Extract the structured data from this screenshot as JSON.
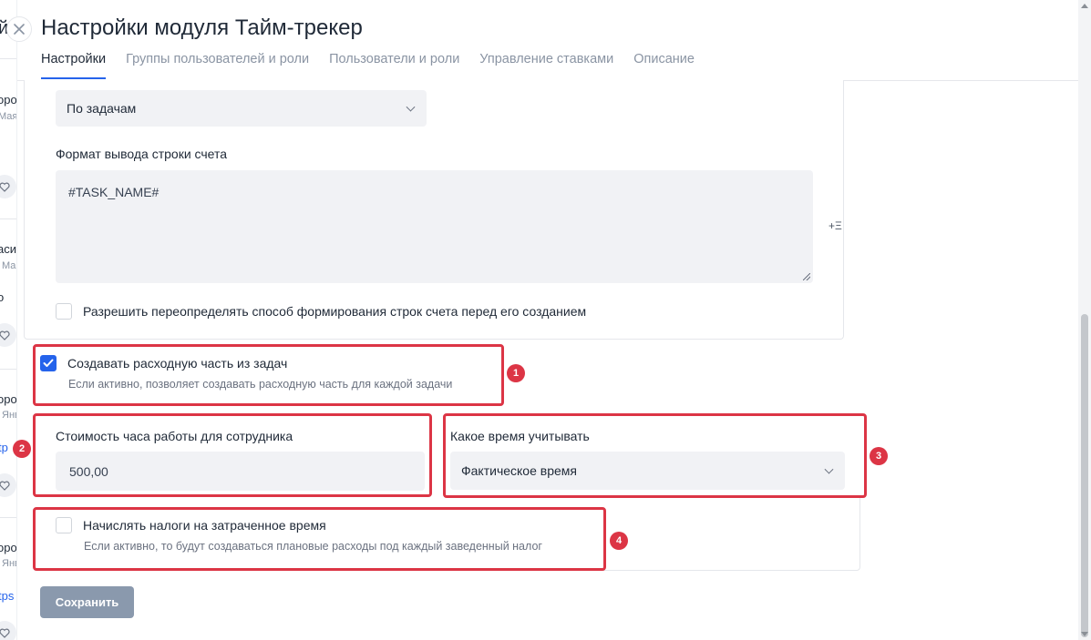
{
  "background": {
    "heading_fragment": "й",
    "items": [
      {
        "title": "оро",
        "sub": "Мая"
      },
      {
        "title": "асил",
        "sub": "Ма"
      },
      {
        "title": "оро",
        "sub": "Янв",
        "link": "tp"
      },
      {
        "title": "оро",
        "sub": "Янв",
        "link": "tps"
      }
    ],
    "stray_text": "о"
  },
  "modal": {
    "title": "Настройки модуля Тайм-трекер",
    "tabs": [
      {
        "label": "Настройки",
        "active": true
      },
      {
        "label": "Группы пользователей и роли",
        "active": false
      },
      {
        "label": "Пользователи и роли",
        "active": false
      },
      {
        "label": "Управление ставками",
        "active": false
      },
      {
        "label": "Описание",
        "active": false
      }
    ]
  },
  "form": {
    "grouping_select": {
      "value": "По задачам"
    },
    "invoice_format": {
      "label": "Формат вывода строки счета",
      "value": "#TASK_NAME#",
      "insert_icon": "+Ξ"
    },
    "allow_override": {
      "label": "Разрешить переопределять способ формирования строк счета перед его созданием",
      "checked": false
    },
    "create_expense": {
      "label": "Создавать расходную часть из задач",
      "hint": "Если активно, позволяет создавать расходную часть для каждой задачи",
      "checked": true
    },
    "hour_cost": {
      "label": "Стоимость часа работы для сотрудника",
      "value": "500,00"
    },
    "time_type": {
      "label": "Какое время учитывать",
      "value": "Фактическое время"
    },
    "taxes": {
      "label": "Начислять налоги на затраченное время",
      "hint": "Если активно, то будут создаваться плановые расходы под каждый заведенный налог",
      "checked": false
    },
    "save_label": "Сохранить"
  },
  "annotations": {
    "badges": [
      "1",
      "2",
      "3",
      "4"
    ],
    "color": "#dc3545"
  },
  "colors": {
    "accent": "#2563eb",
    "save_button": "#8a99ad",
    "field_bg": "#f1f2f5"
  }
}
